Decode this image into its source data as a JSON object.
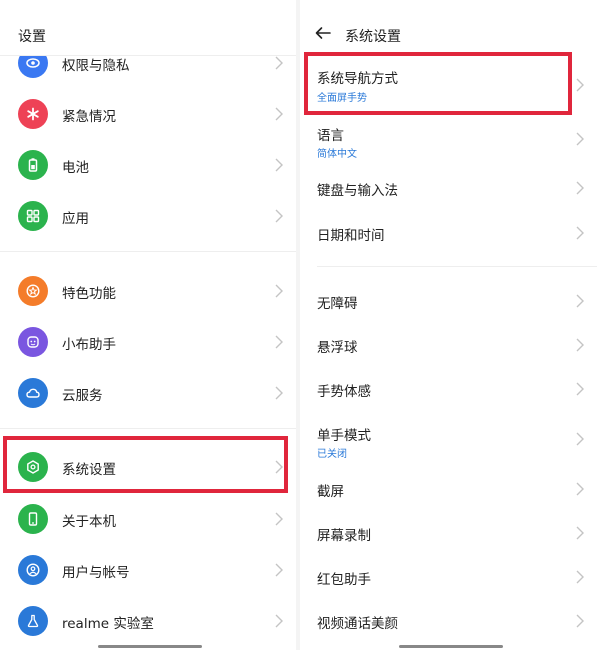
{
  "left": {
    "title": "设置",
    "items": [
      {
        "label": "权限与隐私",
        "icon": "privacy-eye-icon",
        "color": "#3a78f2"
      },
      {
        "label": "紧急情况",
        "icon": "emergency-asterisk-icon",
        "color": "#ee4256"
      },
      {
        "label": "电池",
        "icon": "battery-icon",
        "color": "#2bb34d"
      },
      {
        "label": "应用",
        "icon": "apps-grid-icon",
        "color": "#2bb34d"
      },
      {
        "label": "特色功能",
        "icon": "star-badge-icon",
        "color": "#f47c2a"
      },
      {
        "label": "小布助手",
        "icon": "assistant-icon",
        "color": "#7a56e0"
      },
      {
        "label": "云服务",
        "icon": "cloud-icon",
        "color": "#2a79d8"
      },
      {
        "label": "系统设置",
        "icon": "system-hexagon-icon",
        "color": "#2bb34d"
      },
      {
        "label": "关于本机",
        "icon": "phone-icon",
        "color": "#2bb34d"
      },
      {
        "label": "用户与帐号",
        "icon": "user-icon",
        "color": "#2a79d8"
      },
      {
        "label": "realme 实验室",
        "icon": "lab-flask-icon",
        "color": "#2a79d8"
      }
    ]
  },
  "right": {
    "title": "系统设置",
    "items": [
      {
        "label": "系统导航方式",
        "sub": "全面屏手势"
      },
      {
        "label": "语言",
        "sub": "简体中文"
      },
      {
        "label": "键盘与输入法",
        "sub": ""
      },
      {
        "label": "日期和时间",
        "sub": ""
      },
      {
        "label": "无障碍",
        "sub": ""
      },
      {
        "label": "悬浮球",
        "sub": ""
      },
      {
        "label": "手势体感",
        "sub": ""
      },
      {
        "label": "单手模式",
        "sub": "已关闭"
      },
      {
        "label": "截屏",
        "sub": ""
      },
      {
        "label": "屏幕录制",
        "sub": ""
      },
      {
        "label": "红包助手",
        "sub": ""
      },
      {
        "label": "视频通话美颜",
        "sub": ""
      }
    ]
  },
  "colors": {
    "highlight": "#e0263c",
    "sub_text": "#2a79d8"
  }
}
